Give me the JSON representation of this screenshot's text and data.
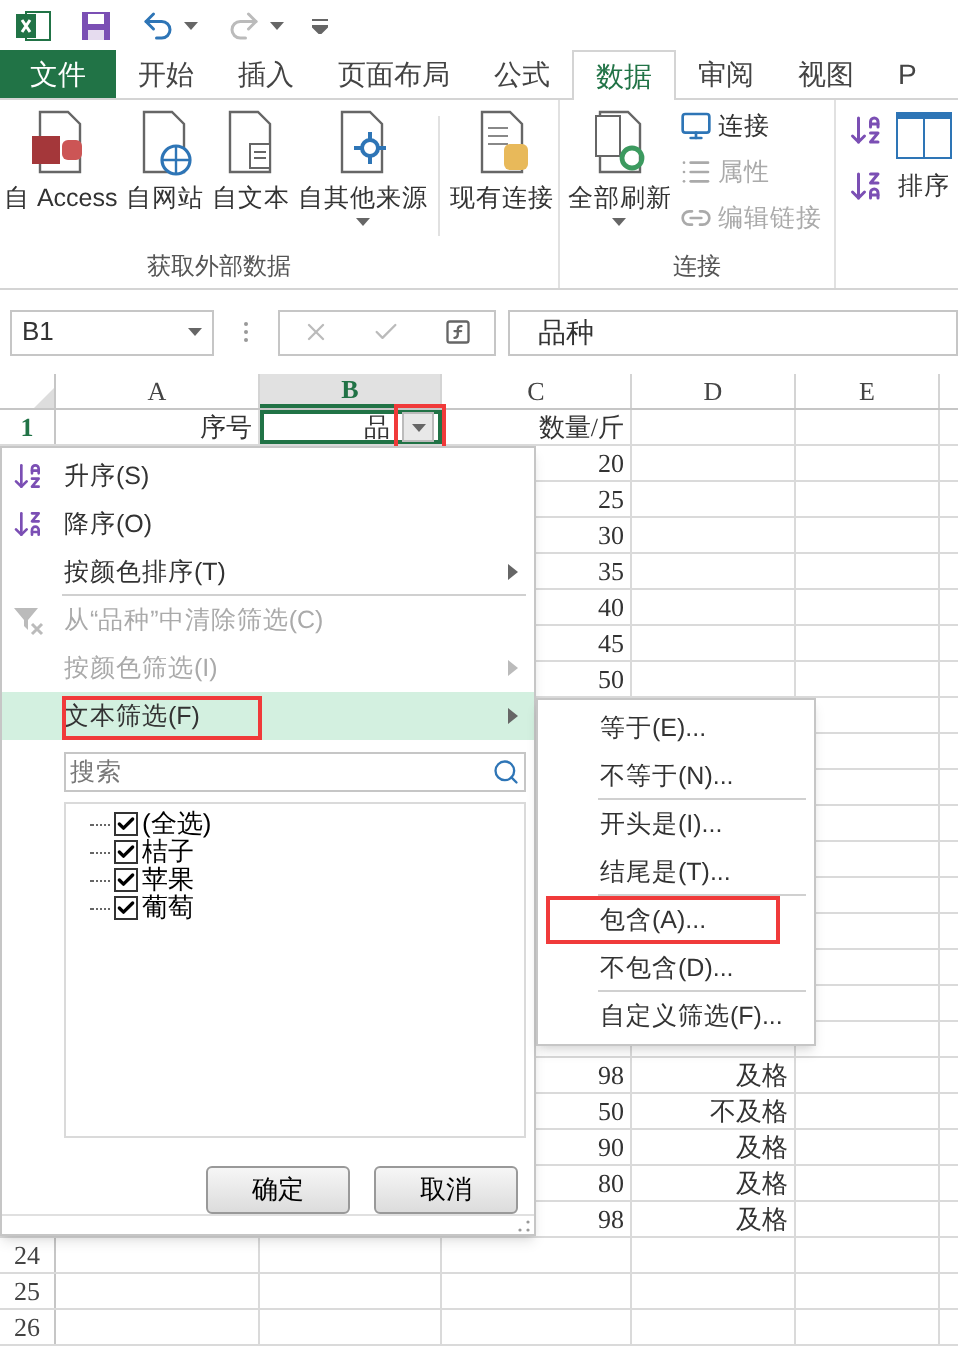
{
  "tabs": [
    {
      "label": "文件",
      "kind": "file",
      "selected": false
    },
    {
      "label": "开始",
      "kind": "tab",
      "selected": false
    },
    {
      "label": "插入",
      "kind": "tab",
      "selected": false
    },
    {
      "label": "页面布局",
      "kind": "tab",
      "selected": false
    },
    {
      "label": "公式",
      "kind": "tab",
      "selected": false
    },
    {
      "label": "数据",
      "kind": "tab",
      "selected": true
    },
    {
      "label": "审阅",
      "kind": "tab",
      "selected": false
    },
    {
      "label": "视图",
      "kind": "tab",
      "selected": false
    },
    {
      "label": "P",
      "kind": "tab",
      "selected": false
    }
  ],
  "ribbon": {
    "external_data": {
      "title": "获取外部数据",
      "buttons": [
        {
          "label": "自 Access",
          "kind": "access",
          "has_menu": false
        },
        {
          "label": "自网站",
          "kind": "web",
          "has_menu": false
        },
        {
          "label": "自文本",
          "kind": "text",
          "has_menu": false
        },
        {
          "label": "自其他来源",
          "kind": "other",
          "has_menu": true
        }
      ],
      "existing": {
        "label": "现有连接"
      }
    },
    "connections": {
      "title": "连接",
      "refresh": {
        "label": "全部刷新",
        "has_menu": true
      },
      "items": [
        {
          "label": "连接",
          "kind": "connections",
          "disabled": false
        },
        {
          "label": "属性",
          "kind": "properties",
          "disabled": true
        },
        {
          "label": "编辑链接",
          "kind": "edit-links",
          "disabled": true
        }
      ]
    },
    "sort": {
      "label": "排序"
    }
  },
  "formula_bar": {
    "name_box": "B1",
    "value": "品种"
  },
  "sheet": {
    "columns": [
      {
        "label": "A",
        "selected": false
      },
      {
        "label": "B",
        "selected": true
      },
      {
        "label": "C",
        "selected": false
      },
      {
        "label": "D",
        "selected": false
      },
      {
        "label": "E",
        "selected": false
      }
    ],
    "filter_button": {
      "highlighted": true
    },
    "rows": [
      {
        "number": "1",
        "cells": {
          "A": "序号",
          "B": "品",
          "C": "数量/斤"
        }
      },
      {
        "cells": {
          "C": "20"
        }
      },
      {
        "cells": {
          "C": "25"
        }
      },
      {
        "cells": {
          "C": "30"
        }
      },
      {
        "cells": {
          "C": "35"
        }
      },
      {
        "cells": {
          "C": "40"
        }
      },
      {
        "cells": {
          "C": "45"
        }
      },
      {
        "cells": {
          "C": "50"
        }
      },
      {},
      {},
      {},
      {},
      {},
      {},
      {},
      {},
      {},
      {},
      {
        "cells": {
          "C": "98",
          "D": "及格"
        }
      },
      {
        "cells": {
          "C": "50",
          "D": "不及格"
        }
      },
      {
        "cells": {
          "C": "90",
          "D": "及格"
        }
      },
      {
        "cells": {
          "C": "80",
          "D": "及格"
        }
      },
      {
        "cells": {
          "C": "98",
          "D": "及格"
        }
      },
      {
        "number": "24"
      },
      {
        "number": "25"
      },
      {
        "number": "26"
      }
    ]
  },
  "filter_menu": {
    "items": [
      {
        "label": "升序(S)",
        "kind": "sort-ascending",
        "disabled": false,
        "active": false,
        "highlighted": false,
        "has_submenu": false,
        "separator_after": false
      },
      {
        "label": "降序(O)",
        "kind": "sort-descending",
        "disabled": false,
        "active": false,
        "highlighted": false,
        "has_submenu": false,
        "separator_after": false
      },
      {
        "label": "按颜色排序(T)",
        "kind": "plain",
        "disabled": false,
        "active": false,
        "highlighted": false,
        "has_submenu": true,
        "separator_after": true
      },
      {
        "label": "从“品种”中清除筛选(C)",
        "kind": "clear-filter",
        "disabled": true,
        "active": false,
        "highlighted": false,
        "has_submenu": false,
        "separator_after": false
      },
      {
        "label": "按颜色筛选(I)",
        "kind": "plain",
        "disabled": true,
        "active": false,
        "highlighted": false,
        "has_submenu": true,
        "separator_after": false
      },
      {
        "label": "文本筛选(F)",
        "kind": "plain",
        "disabled": false,
        "active": true,
        "highlighted": true,
        "has_submenu": true,
        "separator_after": false
      }
    ],
    "search": {
      "placeholder": "搜索"
    },
    "values": [
      {
        "label": "(全选)",
        "checked": true,
        "children": [
          {
            "label": "桔子",
            "checked": true
          },
          {
            "label": "苹果",
            "checked": true
          },
          {
            "label": "葡萄",
            "checked": true
          }
        ]
      }
    ],
    "buttons": [
      "确定",
      "取消"
    ]
  },
  "text_filter_menu": {
    "items": [
      {
        "label": "等于(E)...",
        "highlighted": false,
        "separator_after": false
      },
      {
        "label": "不等于(N)...",
        "highlighted": false,
        "separator_after": true
      },
      {
        "label": "开头是(I)...",
        "highlighted": false,
        "separator_after": false
      },
      {
        "label": "结尾是(T)...",
        "highlighted": false,
        "separator_after": true
      },
      {
        "label": "包含(A)...",
        "highlighted": true,
        "separator_after": false
      },
      {
        "label": "不包含(D)...",
        "highlighted": false,
        "separator_after": true
      },
      {
        "label": "自定义筛选(F)...",
        "highlighted": false,
        "separator_after": false
      }
    ]
  }
}
